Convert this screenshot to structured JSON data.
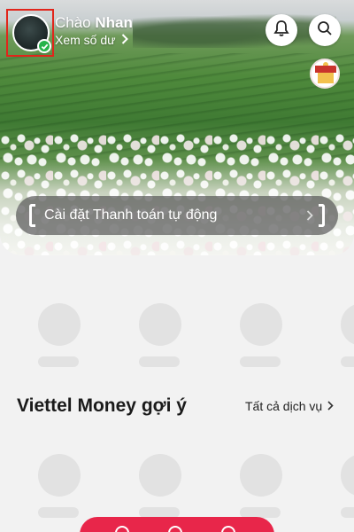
{
  "header": {
    "greeting_prefix": "Chào",
    "user_name": "Nhan",
    "balance_link": "Xem số dư"
  },
  "icons": {
    "avatar_check": "check-icon",
    "balance_chevron": "chevron-right-icon",
    "notification": "bell-icon",
    "search": "search-icon",
    "promo": "promo-badge-icon"
  },
  "autopay_banner": {
    "label": "Cài đặt Thanh toán tự động"
  },
  "suggestions": {
    "title": "Viettel Money gợi ý",
    "all_services_link": "Tất cả dịch vụ"
  },
  "colors": {
    "brand_red": "#e8264a",
    "verified_green": "#27b34a",
    "skeleton": "#e2e2e2",
    "background": "#f2f2f2"
  }
}
